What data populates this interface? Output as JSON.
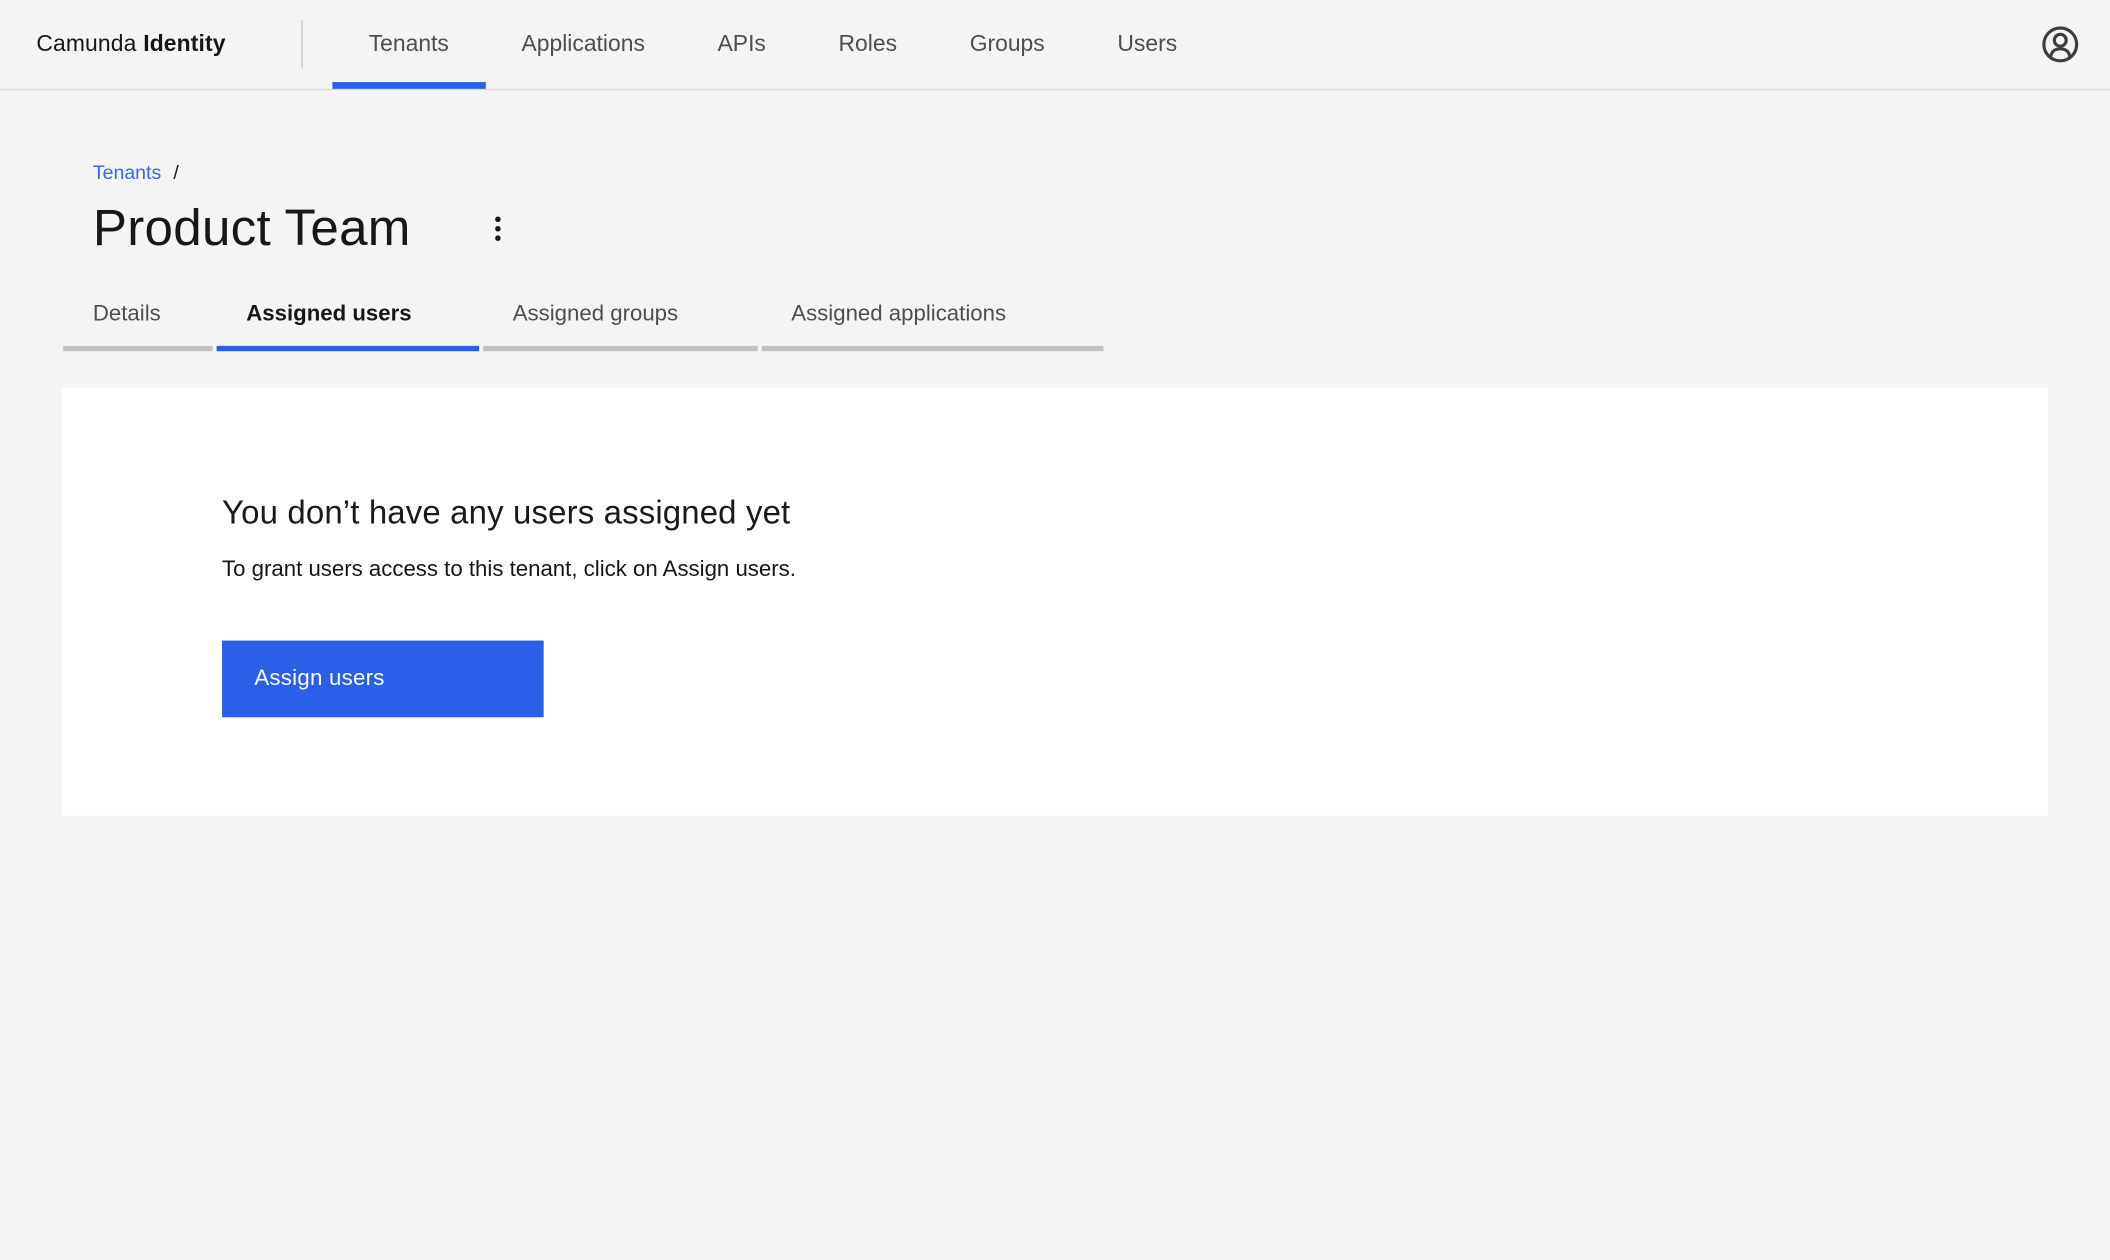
{
  "colors": {
    "page_bg": "#f4f4f4",
    "surface": "#ffffff",
    "text_primary": "#161616",
    "text_secondary": "#4e4e4e",
    "accent": "#2a5fe8",
    "link": "#3a67f1",
    "tab_inactive_bar": "#c2c2c2",
    "header_border": "#d7d7d7",
    "divider": "#c6c6c6",
    "icon": "#3d3d3d",
    "button_text": "#ffffff"
  },
  "header": {
    "brand": {
      "prefix": "Camunda",
      "suffix": "Identity"
    },
    "nav": {
      "items": [
        {
          "label": "Tenants",
          "active": true
        },
        {
          "label": "Applications",
          "active": false
        },
        {
          "label": "APIs",
          "active": false
        },
        {
          "label": "Roles",
          "active": false
        },
        {
          "label": "Groups",
          "active": false
        },
        {
          "label": "Users",
          "active": false
        }
      ]
    },
    "avatar_icon": "user-avatar-icon"
  },
  "breadcrumb": {
    "items": [
      {
        "label": "Tenants"
      }
    ],
    "separator": "/"
  },
  "page": {
    "title": "Product Team",
    "overflow_menu_icon": "kebab-menu-icon"
  },
  "tabs": {
    "items": [
      {
        "label": "Details",
        "active": false
      },
      {
        "label": "Assigned users",
        "active": true
      },
      {
        "label": "Assigned groups",
        "active": false
      },
      {
        "label": "Assigned applications",
        "active": false
      }
    ]
  },
  "empty_state": {
    "heading": "You don’t have any users assigned yet",
    "description": "To grant users access to this tenant, click on Assign users.",
    "action_label": "Assign users"
  }
}
